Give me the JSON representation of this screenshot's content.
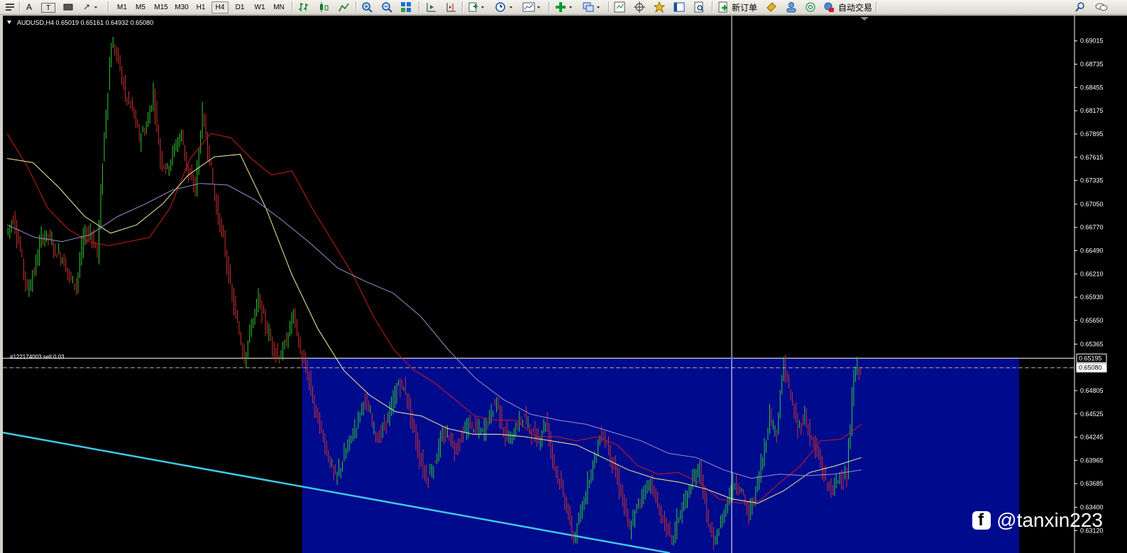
{
  "toolbar": {
    "timeframes": [
      "M1",
      "M5",
      "M15",
      "M30",
      "H1",
      "H4",
      "D1",
      "W1",
      "MN"
    ],
    "active_timeframe": "H4",
    "new_order_label": "新订单",
    "auto_trading_label": "自动交易",
    "text_tool_label": "A",
    "text_label_tool": "T"
  },
  "chart_header": {
    "symbol_info": "AUDUSD,H4  0.65019 0.65161 0.64932 0.65080"
  },
  "order_line_label": "#122174003 sell 0.03",
  "watermark": "@tanxin223",
  "colors": {
    "background": "#000000",
    "bull_candle": "#33cc33",
    "bear_candle": "#cc3333",
    "ma_red": "#c81e1e",
    "ma_yellow": "#f0f09a",
    "ma_lavender": "#9a8ecc",
    "trendline": "#3ec8e6",
    "rectangle": "#000a8c",
    "price_line": "#ffffff"
  },
  "chart_data": {
    "type": "line",
    "symbol": "AUDUSD",
    "timeframe": "H4",
    "ohlc_current": {
      "open": 0.65019,
      "high": 0.65161,
      "low": 0.64932,
      "close": 0.6508
    },
    "y_ticks": [
      "0.69015",
      "0.68735",
      "0.68455",
      "0.68175",
      "0.67895",
      "0.67615",
      "0.67335",
      "0.67050",
      "0.66770",
      "0.66490",
      "0.66210",
      "0.65930",
      "0.65650",
      "0.65365",
      "0.64805",
      "0.64525",
      "0.64245",
      "0.63965",
      "0.63685",
      "0.63400",
      "0.63120"
    ],
    "ylim": [
      0.6285,
      0.6932
    ],
    "price_labels": [
      {
        "label": "0.65195",
        "value": 0.65195
      },
      {
        "label": "0.65080",
        "value": 0.6508
      }
    ],
    "series": [
      {
        "role": "price",
        "values": [
          0.667,
          0.6688,
          0.665,
          0.66,
          0.6625,
          0.6665,
          0.6668,
          0.6648,
          0.664,
          0.6618,
          0.6608,
          0.6665,
          0.6672,
          0.6645,
          0.679,
          0.6898,
          0.688,
          0.6835,
          0.682,
          0.6785,
          0.6798,
          0.6838,
          0.676,
          0.6748,
          0.6772,
          0.679,
          0.674,
          0.6725,
          0.6815,
          0.676,
          0.67,
          0.6662,
          0.6605,
          0.656,
          0.652,
          0.656,
          0.659,
          0.656,
          0.6535,
          0.652,
          0.654,
          0.6575,
          0.6525,
          0.65,
          0.646,
          0.643,
          0.64,
          0.6375,
          0.6395,
          0.642,
          0.644,
          0.647,
          0.645,
          0.642,
          0.644,
          0.646,
          0.649,
          0.648,
          0.644,
          0.64,
          0.6375,
          0.639,
          0.642,
          0.643,
          0.641,
          0.6425,
          0.644,
          0.6435,
          0.643,
          0.645,
          0.647,
          0.643,
          0.642,
          0.644,
          0.645,
          0.643,
          0.642,
          0.6445,
          0.64,
          0.637,
          0.634,
          0.63,
          0.633,
          0.637,
          0.64,
          0.643,
          0.641,
          0.638,
          0.635,
          0.631,
          0.634,
          0.636,
          0.637,
          0.634,
          0.632,
          0.63,
          0.633,
          0.635,
          0.637,
          0.639,
          0.633,
          0.6295,
          0.632,
          0.635,
          0.637,
          0.636,
          0.633,
          0.636,
          0.64,
          0.645,
          0.643,
          0.6515,
          0.647,
          0.6435,
          0.645,
          0.642,
          0.64,
          0.637,
          0.636,
          0.638,
          0.6375,
          0.65,
          0.651
        ]
      },
      {
        "role": "ma-fast",
        "values": [
          0.679,
          0.675,
          0.67,
          0.6675,
          0.666,
          0.6655,
          0.666,
          0.6665,
          0.67,
          0.676,
          0.679,
          0.6785,
          0.676,
          0.674,
          0.6745,
          0.67,
          0.666,
          0.662,
          0.657,
          0.653,
          0.6505,
          0.649,
          0.647,
          0.645,
          0.6445,
          0.6445,
          0.6425,
          0.6425,
          0.642,
          0.6425,
          0.6415,
          0.639,
          0.638,
          0.6382,
          0.637,
          0.635,
          0.6345,
          0.6348,
          0.637,
          0.639,
          0.642,
          0.6422,
          0.644
        ]
      },
      {
        "role": "ma-mid",
        "values": [
          0.676,
          0.6755,
          0.6725,
          0.669,
          0.667,
          0.668,
          0.6705,
          0.674,
          0.6762,
          0.6765,
          0.67,
          0.662,
          0.6555,
          0.6505,
          0.6475,
          0.6455,
          0.645,
          0.6435,
          0.6428,
          0.6428,
          0.6425,
          0.642,
          0.6415,
          0.64,
          0.6385,
          0.6375,
          0.637,
          0.6362,
          0.635,
          0.6345,
          0.636,
          0.6382,
          0.639,
          0.64
        ]
      },
      {
        "role": "ma-slow",
        "values": [
          0.668,
          0.6665,
          0.666,
          0.6668,
          0.669,
          0.6705,
          0.6722,
          0.673,
          0.6728,
          0.671,
          0.6685,
          0.6658,
          0.6628,
          0.6612,
          0.6598,
          0.657,
          0.653,
          0.6495,
          0.647,
          0.6452,
          0.6445,
          0.644,
          0.643,
          0.642,
          0.6405,
          0.64,
          0.6385,
          0.6375,
          0.638,
          0.6378,
          0.638,
          0.6385
        ]
      }
    ],
    "trendline": {
      "start": 0.643,
      "end": 0.6285
    },
    "rectangle": {
      "top": 0.65195,
      "bottom": 0.6285
    }
  }
}
